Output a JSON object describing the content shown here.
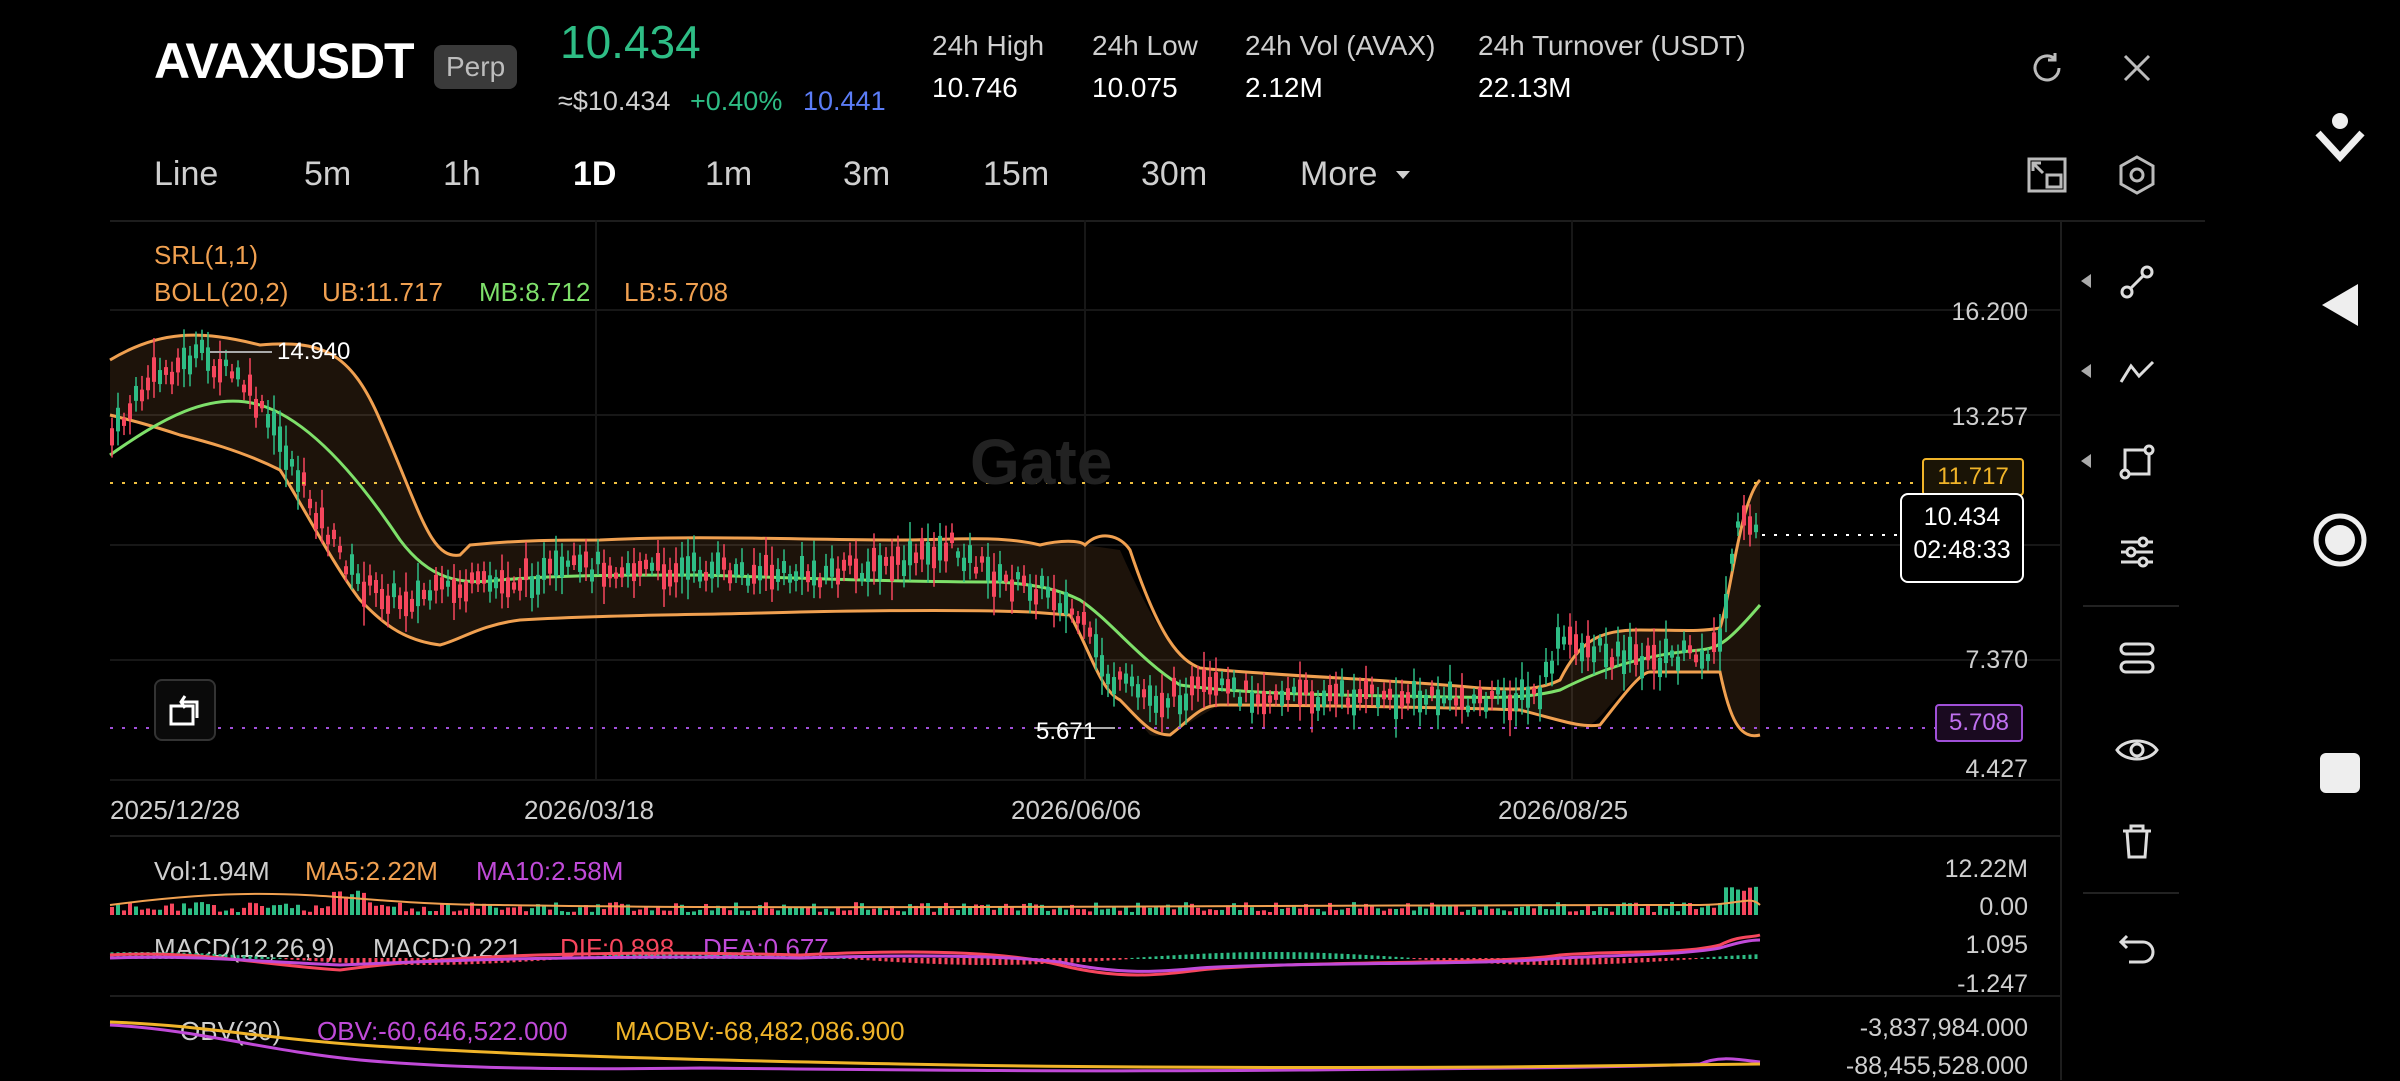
{
  "header": {
    "symbol": "AVAXUSDT",
    "type_badge": "Perp",
    "last_price": "10.434",
    "usd_price": "≈$10.434",
    "change_pct": "+0.40%",
    "mark_price": "10.441",
    "stats": [
      {
        "label": "24h High",
        "value": "10.746"
      },
      {
        "label": "24h Low",
        "value": "10.075"
      },
      {
        "label": "24h Vol (AVAX)",
        "value": "2.12M"
      },
      {
        "label": "24h Turnover (USDT)",
        "value": "22.13M"
      }
    ]
  },
  "timeframes": [
    "Line",
    "5m",
    "1h",
    "1D",
    "1m",
    "3m",
    "15m",
    "30m"
  ],
  "active_timeframe": "1D",
  "more_label": "More",
  "indicators": {
    "srl": "SRL(1,1)",
    "boll": "BOLL(20,2)",
    "ub": "UB:11.717",
    "mb": "MB:8.712",
    "lb": "LB:5.708"
  },
  "watermark": "Gate",
  "main_chart": {
    "y_ticks": [
      "16.200",
      "13.257",
      "7.370",
      "4.427"
    ],
    "x_ticks": [
      "2025/12/28",
      "2026/03/18",
      "2026/06/06",
      "2026/08/25"
    ],
    "high_marker": "14.940",
    "low_marker": "5.671",
    "ub_tag": "11.717",
    "lb_tag": "5.708",
    "last_price_tag": "10.434",
    "countdown": "02:48:33"
  },
  "volume": {
    "vol": "Vol:1.94M",
    "ma5": "MA5:2.22M",
    "ma10": "MA10:2.58M",
    "y_top": "12.22M",
    "y_bottom": "0.00"
  },
  "macd": {
    "label": "MACD(12,26,9)",
    "value": "MACD:0.221",
    "dif": "DIF:0.898",
    "dea": "DEA:0.677",
    "y_top": "1.095",
    "y_bottom": "-1.247"
  },
  "obv": {
    "label": "OBV(30)",
    "value": "OBV:-60,646,522.000",
    "maobv": "MAOBV:-68,482,086.900",
    "y_top": "-3,837,984.000",
    "y_bottom": "-88,455,528.000"
  },
  "colors": {
    "up": "#2ebd85",
    "down": "#f6465d",
    "boll": "#f0a050",
    "mb": "#7ee06a",
    "purple": "#c04ad8",
    "yellow": "#f0b429"
  },
  "tools": [
    "trendline-tool-icon",
    "fib-tool-icon",
    "shape-tool-icon",
    "adjust-tool-icon",
    "settings-tool-icon",
    "eye-icon",
    "trash-icon",
    "undo-icon"
  ]
}
